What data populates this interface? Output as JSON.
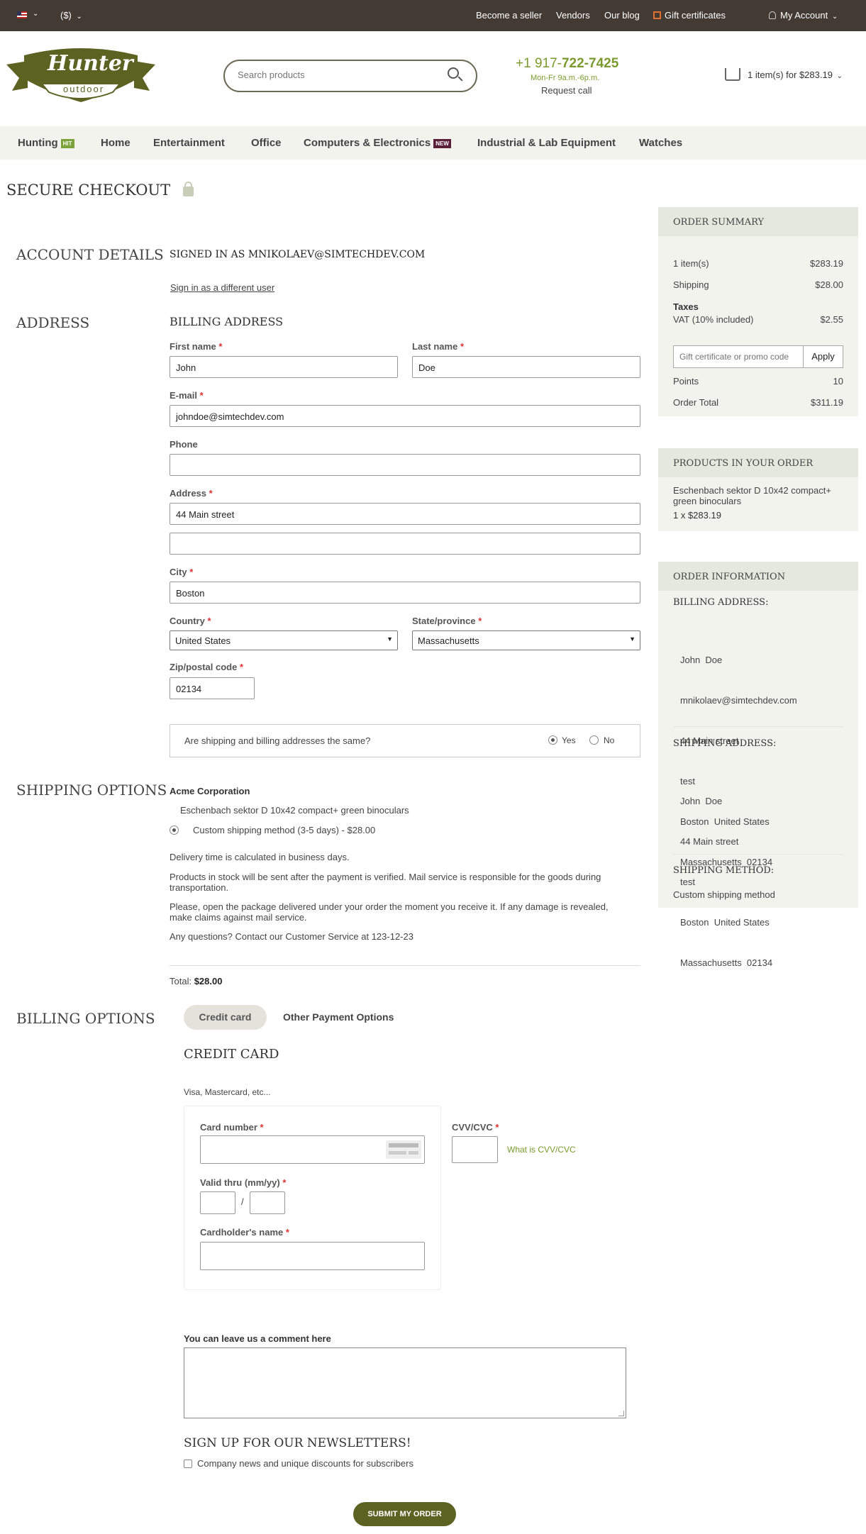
{
  "topbar": {
    "flag": "flag-icon",
    "currency": "($)",
    "links": [
      "Become a seller",
      "Vendors",
      "Our blog"
    ],
    "gift": "Gift certificates",
    "account": "My Account"
  },
  "header": {
    "logo_main": "Hunter",
    "logo_sub": "outdoor",
    "search_placeholder": "Search products",
    "phone_prefix": "+1 917-",
    "phone_main": "722-7425",
    "hours": "Mon-Fr 9a.m.-6p.m.",
    "request_call": "Request call",
    "cart": "1 item(s) for $283.19"
  },
  "nav": {
    "items": [
      "Hunting",
      "Home",
      "Entertainment",
      "Office",
      "Computers & Electronics",
      "Industrial & Lab Equipment",
      "Watches"
    ],
    "hit": "HIT",
    "new": "NEW"
  },
  "page_title": "SECURE CHECKOUT",
  "account": {
    "heading": "ACCOUNT DETAILS",
    "signed_in": "SIGNED IN AS MNIKOLAEV@SIMTECHDEV.COM",
    "switch_user": "Sign in as a different user"
  },
  "address": {
    "heading": "ADDRESS",
    "billing_heading": "BILLING ADDRESS",
    "first_name_label": "First name",
    "first_name": "John",
    "last_name_label": "Last name",
    "last_name": "Doe",
    "email_label": "E-mail",
    "email": "johndoe@simtechdev.com",
    "phone_label": "Phone",
    "phone": "",
    "address_label": "Address",
    "address1": "44 Main street",
    "address2": "",
    "city_label": "City",
    "city": "Boston",
    "country_label": "Country",
    "country": "United States",
    "state_label": "State/province",
    "state": "Massachusetts",
    "zip_label": "Zip/postal code",
    "zip": "02134",
    "same_question": "Are shipping and billing addresses the same?",
    "yes": "Yes",
    "no": "No"
  },
  "shipping": {
    "heading": "SHIPPING OPTIONS",
    "vendor": "Acme Corporation",
    "product": "Eschenbach sektor D 10x42 compact+ green binoculars",
    "method": "Custom shipping method (3-5 days) - $28.00",
    "info1": "Delivery time is calculated in business days.",
    "info2a": "Products in stock will be sent after the payment is verified. Mail service is responsible for the goods during",
    "info2b": "transportation.",
    "info3a": "Please, open the package delivered under your order the moment you receive it. If any damage is revealed,",
    "info3b": "make claims against mail service.",
    "info4": "Any questions? Contact our Customer Service at 123-12-23",
    "total_label": "Total:",
    "total": "$28.00"
  },
  "billing": {
    "heading": "BILLING OPTIONS",
    "tab_card": "Credit card",
    "tab_other": "Other Payment Options",
    "card_heading": "CREDIT CARD",
    "card_desc": "Visa, Mastercard, etc...",
    "card_number_label": "Card number",
    "valid_label": "Valid thru (mm/yy)",
    "slash": "/",
    "holder_label": "Cardholder's name",
    "cvv_label": "CVV/CVC",
    "cvv_link": "What is CVV/CVC"
  },
  "comment_label": "You can leave us a comment here",
  "newsletter": {
    "heading": "SIGN UP FOR OUR NEWSLETTERS!",
    "option": "Company news and unique discounts for subscribers"
  },
  "submit": "SUBMIT MY ORDER",
  "summary": {
    "heading": "ORDER SUMMARY",
    "items_label": "1 item(s)",
    "items_value": "$283.19",
    "shipping_label": "Shipping",
    "shipping_value": "$28.00",
    "taxes_label": "Taxes",
    "vat_label": "VAT (10% included)",
    "vat_value": "$2.55",
    "promo_placeholder": "Gift certificate or promo code",
    "apply": "Apply",
    "points_label": "Points",
    "points_value": "10",
    "total_label": "Order Total",
    "total_value": "$311.19"
  },
  "products": {
    "heading": "PRODUCTS IN YOUR ORDER",
    "name1": "Eschenbach sektor D 10x42 compact+",
    "name2": "green binoculars",
    "qty": "1 x $283.19"
  },
  "order_info": {
    "heading": "ORDER INFORMATION",
    "billing_heading": "BILLING ADDRESS:",
    "billing_lines": [
      "John  Doe",
      "mnikolaev@simtechdev.com",
      "44 Main street",
      "test",
      "Boston  United States",
      "Massachusetts  02134"
    ],
    "shipping_heading": "SHIPPING ADDRESS:",
    "shipping_lines": [
      "John  Doe",
      "44 Main street",
      "test",
      "Boston  United States",
      "Massachusetts  02134"
    ],
    "method_heading": "SHIPPING METHOD:",
    "method": "Custom shipping method"
  },
  "colors": {
    "topbar": "#443a34",
    "brand": "#5a6322",
    "accent_green": "#7a9a2e",
    "nav_bg": "#f3f3ee",
    "side_bg": "#f3f3ee",
    "side_head": "#e5e8de",
    "hit_badge": "#7aa33a",
    "new_badge": "#5b1f3a",
    "gift_icon": "#e07030"
  }
}
